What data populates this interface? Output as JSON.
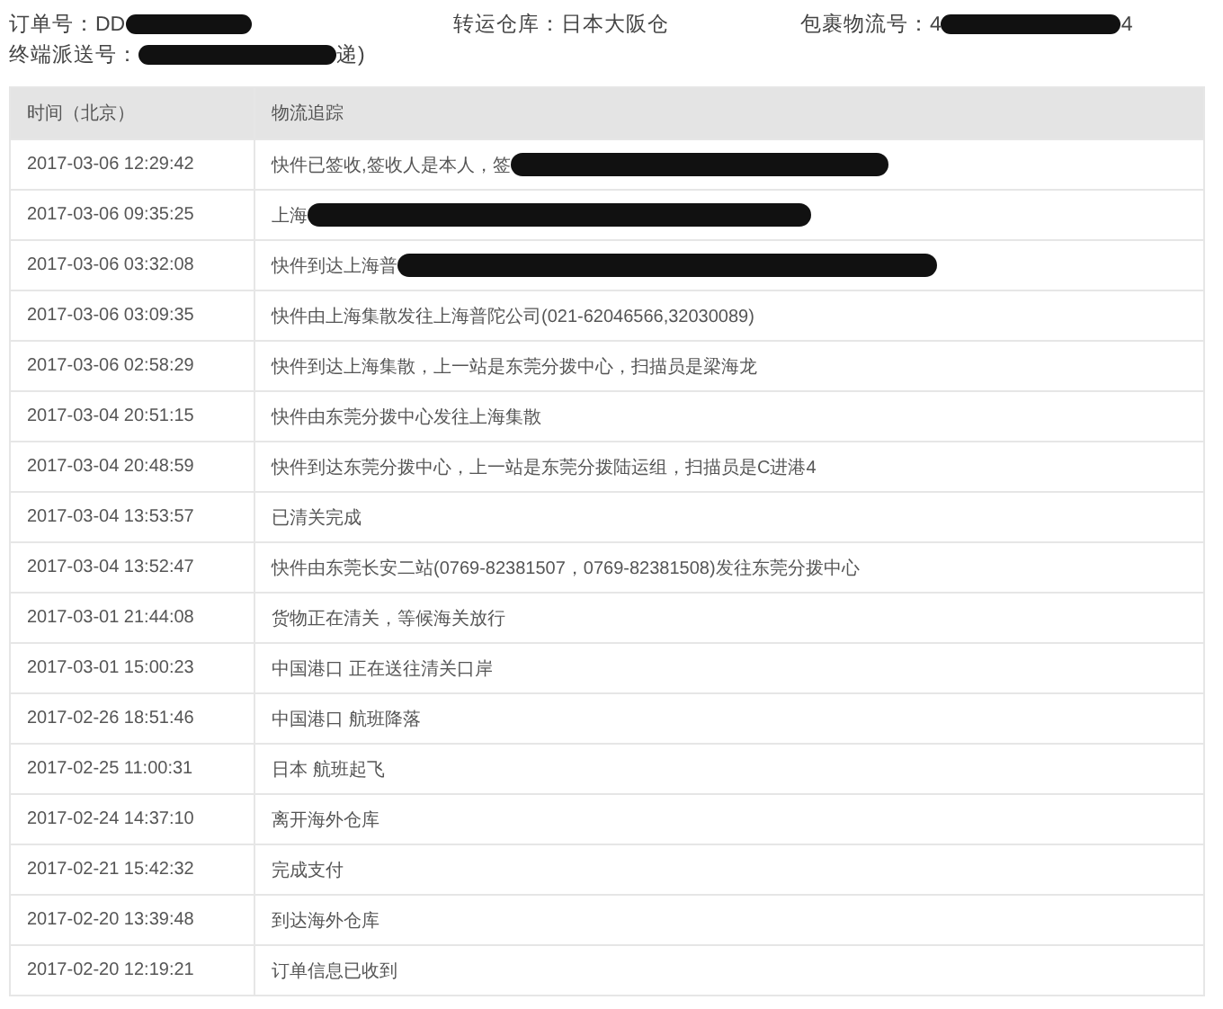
{
  "order_info": [
    {
      "label": "订单号：",
      "value": "DD",
      "redacted": true
    },
    {
      "label": "转运仓库：",
      "value": "日本大阪仓",
      "redacted": false
    },
    {
      "label": "包裹物流号：",
      "value": "4",
      "redacted": true,
      "suffix": "4"
    },
    {
      "label": "终端派送号：",
      "redacted": true,
      "suffix": "递)"
    }
  ],
  "table": {
    "columns": [
      "时间（北京）",
      "物流追踪"
    ],
    "rows": [
      {
        "time": "2017-03-06 12:29:42",
        "event": "快件已签收,签收人是本人，签",
        "redacted": true
      },
      {
        "time": "2017-03-06 09:35:25",
        "event": "上海",
        "redacted": true
      },
      {
        "time": "2017-03-06 03:32:08",
        "event": "快件到达上海普",
        "redacted": true
      },
      {
        "time": "2017-03-06 03:09:35",
        "event": "快件由上海集散发往上海普陀公司(021-62046566,32030089)",
        "redacted": false
      },
      {
        "time": "2017-03-06 02:58:29",
        "event": "快件到达上海集散，上一站是东莞分拨中心，扫描员是梁海龙",
        "redacted": false
      },
      {
        "time": "2017-03-04 20:51:15",
        "event": "快件由东莞分拨中心发往上海集散",
        "redacted": false
      },
      {
        "time": "2017-03-04 20:48:59",
        "event": "快件到达东莞分拨中心，上一站是东莞分拨陆运组，扫描员是C进港4",
        "redacted": false
      },
      {
        "time": "2017-03-04 13:53:57",
        "event": "已清关完成",
        "redacted": false
      },
      {
        "time": "2017-03-04 13:52:47",
        "event": "快件由东莞长安二站(0769-82381507，0769-82381508)发往东莞分拨中心",
        "redacted": false
      },
      {
        "time": "2017-03-01 21:44:08",
        "event": "货物正在清关，等候海关放行",
        "redacted": false
      },
      {
        "time": "2017-03-01 15:00:23",
        "event": "中国港口 正在送往清关口岸",
        "redacted": false
      },
      {
        "time": "2017-02-26 18:51:46",
        "event": "中国港口 航班降落",
        "redacted": false
      },
      {
        "time": "2017-02-25 11:00:31",
        "event": "日本 航班起飞",
        "redacted": false
      },
      {
        "time": "2017-02-24 14:37:10",
        "event": "离开海外仓库",
        "redacted": false
      },
      {
        "time": "2017-02-21 15:42:32",
        "event": "完成支付",
        "redacted": false
      },
      {
        "time": "2017-02-20 13:39:48",
        "event": "到达海外仓库",
        "redacted": false
      },
      {
        "time": "2017-02-20 12:19:21",
        "event": "订单信息已收到",
        "redacted": false
      }
    ]
  }
}
